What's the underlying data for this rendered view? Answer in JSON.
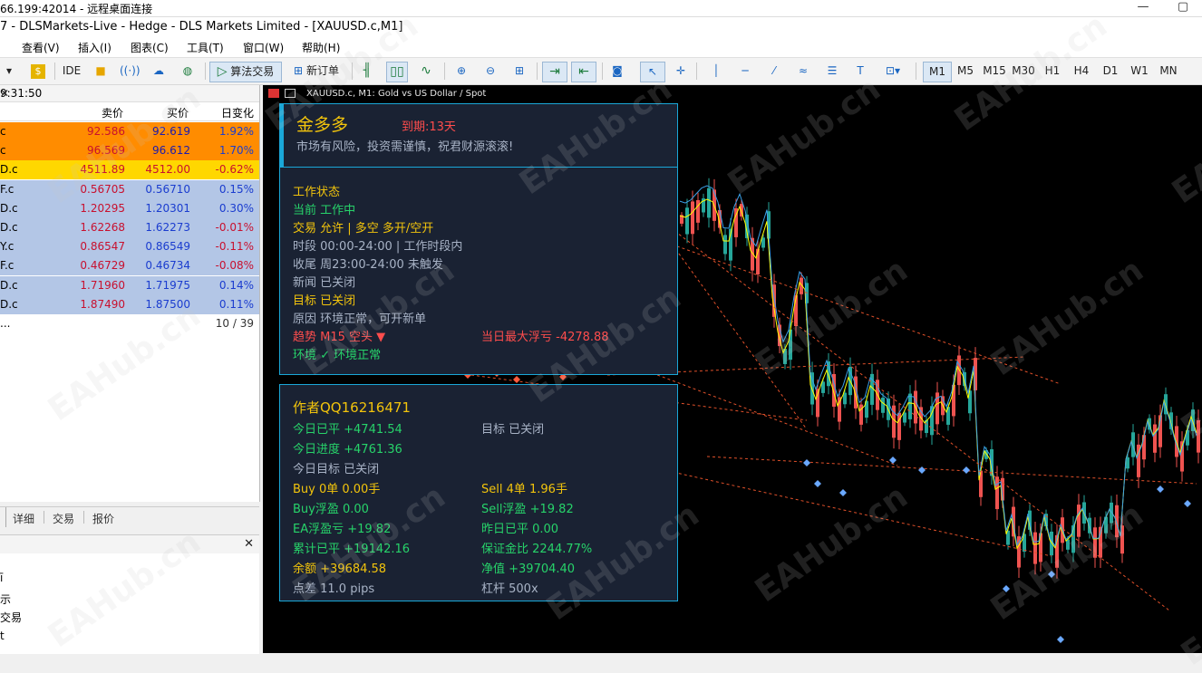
{
  "rdp": {
    "title": "66.199:42014 - 远程桌面连接"
  },
  "titlebar": {
    "title": "7 - DLSMarkets-Live - Hedge - DLS Markets Limited - [XAUUSD.c,M1]"
  },
  "menu": [
    "查看(V)",
    "插入(I)",
    "图表(C)",
    "工具(T)",
    "窗口(W)",
    "帮助(H)"
  ],
  "toolbar": {
    "ide": "IDE",
    "algo": "算法交易",
    "new_order": "新订单",
    "timeframes": [
      "M1",
      "M5",
      "M15",
      "M30",
      "H1",
      "H4",
      "D1",
      "W1",
      "MN"
    ],
    "active_tf": "M1"
  },
  "market": {
    "time": "9:31:50",
    "col_bid": "卖价",
    "col_ask": "买价",
    "col_change": "日变化",
    "rows": [
      {
        "sym": "c",
        "bid": "92.586",
        "ask": "92.619",
        "chg": "1.92%"
      },
      {
        "sym": "c",
        "bid": "96.569",
        "ask": "96.612",
        "chg": "1.70%"
      },
      {
        "sym": "D.c",
        "bid": "4511.89",
        "ask": "4512.00",
        "chg": "-0.62%"
      },
      {
        "sym": "F.c",
        "bid": "0.56705",
        "ask": "0.56710",
        "chg": "0.15%"
      },
      {
        "sym": "D.c",
        "bid": "1.20295",
        "ask": "1.20301",
        "chg": "0.30%"
      },
      {
        "sym": "D.c",
        "bid": "1.62268",
        "ask": "1.62273",
        "chg": "-0.01%"
      },
      {
        "sym": "Y.c",
        "bid": "0.86547",
        "ask": "0.86549",
        "chg": "-0.11%"
      },
      {
        "sym": "F.c",
        "bid": "0.46729",
        "ask": "0.46734",
        "chg": "-0.08%"
      },
      {
        "sym": "D.c",
        "bid": "1.71960",
        "ask": "1.71975",
        "chg": "0.14%"
      },
      {
        "sym": "D.c",
        "bid": "1.87490",
        "ask": "1.87500",
        "chg": "0.11%"
      }
    ],
    "more": "...",
    "count": "10 / 39",
    "tabs": [
      "详细",
      "交易",
      "报价"
    ]
  },
  "navigator": {
    "items": [
      "ī",
      "示",
      "交易",
      "t"
    ]
  },
  "chart": {
    "title": "XAUUSD.c, M1:  Gold vs US Dollar / Spot"
  },
  "ea": {
    "name": "金多多",
    "expiry": "到期:13天",
    "slogan": "市场有风险，投资需谨慎，祝君财源滚滚!",
    "status_title": "工作状态",
    "current": "当前  工作中",
    "trade": "交易  允许  |  多空  多开/空开",
    "period": "时段  00:00-24:00  |  工作时段内",
    "close": "收尾  周23:00-24:00  未触发",
    "news": "新闻  已关闭",
    "target": "目标  已关闭",
    "reason": "原因  环境正常，可开新单",
    "trend": "趋势  M15 空头 ▼",
    "max_float": "当日最大浮亏 -4278.88",
    "env": "环境 ✓ 环境正常",
    "author": "作者QQ16216471",
    "today_closed": "今日已平  +4741.54",
    "target2": "目标  已关闭",
    "today_progress": "今日进度  +4761.36",
    "today_target": "今日目标  已关闭",
    "buy": "Buy  0单  0.00手",
    "sell": "Sell  4单  1.96手",
    "buy_float": "Buy浮盈  0.00",
    "sell_float": "Sell浮盈  +19.82",
    "ea_float": "EA浮盈亏  +19.82",
    "yest_closed": "昨日已平  0.00",
    "cum_closed": "累计已平  +19142.16",
    "margin": "保证金比  2244.77%",
    "balance": "余额  +39684.58",
    "equity": "净值  +39704.40",
    "spread": "点差  11.0 pips",
    "leverage": "杠杆  500x"
  },
  "watermark": "EAHub.cn",
  "colors": {
    "orange": "#ff8c00",
    "gold": "#ffd700",
    "blue_row": "#b3c6e6",
    "panel_border": "#1aa7d8",
    "green": "#27d36a",
    "yellow": "#f2c40c",
    "red": "#ff4d4d"
  }
}
